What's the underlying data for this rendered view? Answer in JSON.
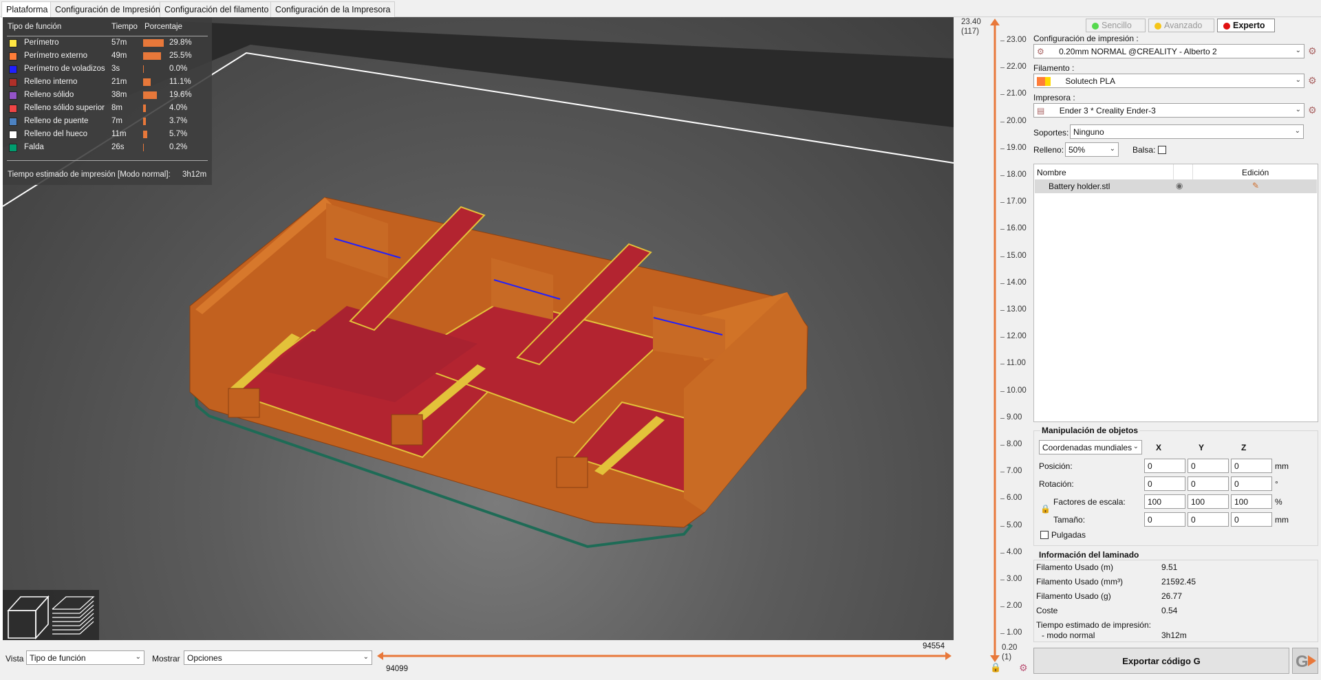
{
  "tabs": [
    "Plataforma",
    "Configuración de Impresión",
    "Configuración del filamento",
    "Configuración de la Impresora"
  ],
  "legend": {
    "col_feature": "Tipo de función",
    "col_time": "Tiempo",
    "col_percent": "Porcentaje",
    "rows": [
      {
        "name": "Perímetro",
        "time": "57m",
        "pct": "29.8%",
        "color": "#ffe643"
      },
      {
        "name": "Perímetro externo",
        "time": "49m",
        "pct": "25.5%",
        "color": "#ff7d38"
      },
      {
        "name": "Perímetro de voladizos",
        "time": "3s",
        "pct": "0.0%",
        "color": "#1f1fff"
      },
      {
        "name": "Relleno interno",
        "time": "21m",
        "pct": "11.1%",
        "color": "#b03029"
      },
      {
        "name": "Relleno sólido",
        "time": "38m",
        "pct": "19.6%",
        "color": "#9454c9"
      },
      {
        "name": "Relleno sólido superior",
        "time": "8m",
        "pct": "4.0%",
        "color": "#f04545"
      },
      {
        "name": "Relleno de puente",
        "time": "7m",
        "pct": "3.7%",
        "color": "#4c82c2"
      },
      {
        "name": "Relleno del hueco",
        "time": "11m",
        "pct": "5.7%",
        "color": "#ffffff"
      },
      {
        "name": "Falda",
        "time": "26s",
        "pct": "0.2%",
        "color": "#009c6e"
      }
    ],
    "estimate_label": "Tiempo estimado de impresión [Modo normal]:",
    "estimate_value": "3h12m"
  },
  "bottom": {
    "vista_label": "Vista",
    "vista_value": "Tipo de función",
    "mostrar_label": "Mostrar",
    "mostrar_value": "Opciones",
    "range_low": "94099",
    "range_high": "94554"
  },
  "layer_slider": {
    "top_height": "23.40",
    "top_layer": "(117)",
    "bottom_height": "0.20",
    "bottom_layer": "(1)",
    "ticks": [
      "23.00",
      "22.00",
      "21.00",
      "20.00",
      "19.00",
      "18.00",
      "17.00",
      "16.00",
      "15.00",
      "14.00",
      "13.00",
      "12.00",
      "11.00",
      "10.00",
      "9.00",
      "8.00",
      "7.00",
      "6.00",
      "5.00",
      "4.00",
      "3.00",
      "2.00",
      "1.00"
    ]
  },
  "modes": [
    {
      "label": "Sencillo",
      "color": "#56d94e",
      "active": false
    },
    {
      "label": "Avanzado",
      "color": "#f5c518",
      "active": false
    },
    {
      "label": "Experto",
      "color": "#e01010",
      "active": true
    }
  ],
  "print_config_label": "Configuración de impresión :",
  "print_config_value": "0.20mm NORMAL @CREALITY - Alberto 2",
  "filament_label": "Filamento :",
  "filament_value": "Solutech PLA",
  "printer_label": "Impresora :",
  "printer_value": "Ender 3 * Creality Ender-3",
  "supports_label": "Soportes:",
  "supports_value": "Ninguno",
  "infill_label": "Relleno:",
  "infill_value": "50%",
  "raft_label": "Balsa:",
  "object_list": {
    "col_name": "Nombre",
    "col_edit": "Edición",
    "items": [
      "Battery holder.stl"
    ]
  },
  "manip": {
    "title": "Manipulación de objetos",
    "coord_value": "Coordenadas mundiales",
    "x": "X",
    "y": "Y",
    "z": "Z",
    "position_label": "Posición:",
    "position": [
      "0",
      "0",
      "0"
    ],
    "position_unit": "mm",
    "rotation_label": "Rotación:",
    "rotation": [
      "0",
      "0",
      "0"
    ],
    "rotation_unit": "°",
    "scale_label": "Factores de escala:",
    "scale": [
      "100",
      "100",
      "100"
    ],
    "scale_unit": "%",
    "size_label": "Tamaño:",
    "size": [
      "0",
      "0",
      "0"
    ],
    "size_unit": "mm",
    "inches_label": "Pulgadas"
  },
  "slice_info": {
    "title": "Información del laminado",
    "rows": [
      {
        "label": "Filamento Usado (m)",
        "value": "9.51"
      },
      {
        "label": "Filamento Usado (mm³)",
        "value": "21592.45"
      },
      {
        "label": "Filamento Usado (g)",
        "value": "26.77"
      },
      {
        "label": "Coste",
        "value": "0.54"
      }
    ],
    "time_label_1": "Tiempo estimado de impresión:",
    "time_label_2": "- modo normal",
    "time_value": "3h12m"
  },
  "export_label": "Exportar código G",
  "colors": {
    "accent": "#e8783a",
    "part": "#c2611f",
    "top": "#b32430",
    "skirt": "#1e6b56"
  }
}
